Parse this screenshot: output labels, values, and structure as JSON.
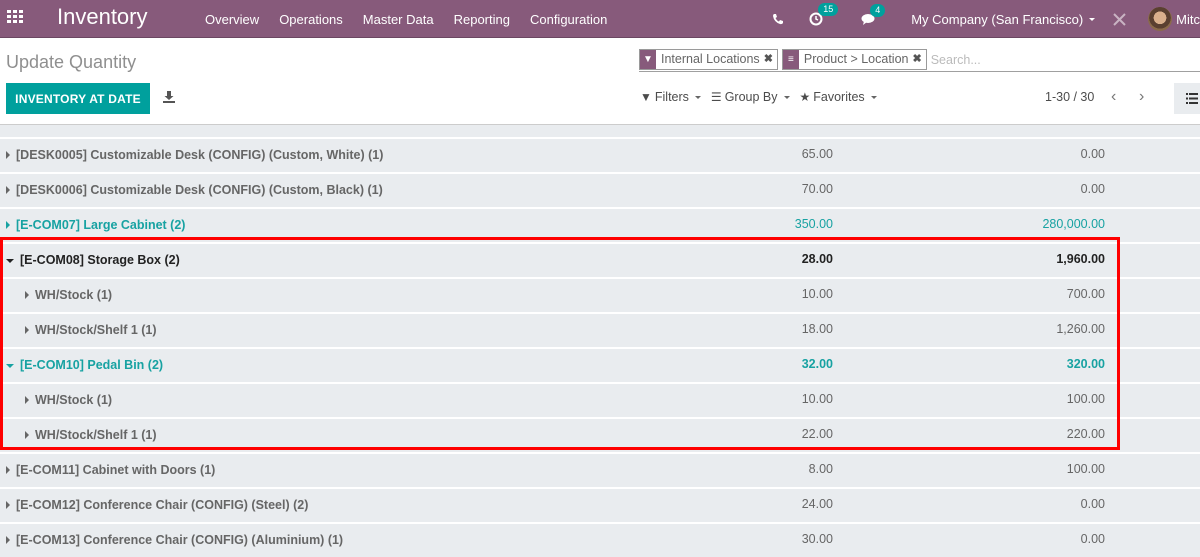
{
  "navbar": {
    "app_title": "Inventory",
    "menu": [
      "Overview",
      "Operations",
      "Master Data",
      "Reporting",
      "Configuration"
    ],
    "activity_count": "15",
    "message_count": "4",
    "company": "My Company (San Francisco)",
    "user_name": "Mitc",
    "colors": {
      "brand": "#875a7b",
      "badge": "#00a09d"
    }
  },
  "control_panel": {
    "breadcrumb": "Update Quantity",
    "primary_button": "INVENTORY AT DATE",
    "search": {
      "facets": [
        {
          "icon": "filter-icon",
          "label": "Internal Locations"
        },
        {
          "icon": "group-by-icon",
          "label": "Product > Location"
        }
      ],
      "placeholder": "Search..."
    },
    "filters_label": "Filters",
    "group_by_label": "Group By",
    "favorites_label": "Favorites",
    "pager": "1-30 / 30"
  },
  "table": {
    "rows": [
      {
        "name": "[DESK0005] Customizable Desk (CONFIG) (Custom, White) (1)",
        "qty": "65.00",
        "value": "0.00"
      },
      {
        "name": "[DESK0006] Customizable Desk (CONFIG) (Custom, Black) (1)",
        "qty": "70.00",
        "value": "0.00"
      },
      {
        "name": "[E-COM07] Large Cabinet (2)",
        "qty": "350.00",
        "value": "280,000.00"
      },
      {
        "name": "[E-COM08] Storage Box (2)",
        "qty": "28.00",
        "value": "1,960.00"
      },
      {
        "name": "WH/Stock (1)",
        "qty": "10.00",
        "value": "700.00"
      },
      {
        "name": "WH/Stock/Shelf 1 (1)",
        "qty": "18.00",
        "value": "1,260.00"
      },
      {
        "name": "[E-COM10] Pedal Bin (2)",
        "qty": "32.00",
        "value": "320.00"
      },
      {
        "name": "WH/Stock (1)",
        "qty": "10.00",
        "value": "100.00"
      },
      {
        "name": "WH/Stock/Shelf 1 (1)",
        "qty": "22.00",
        "value": "220.00"
      },
      {
        "name": "[E-COM11] Cabinet with Doors (1)",
        "qty": "8.00",
        "value": "100.00"
      },
      {
        "name": "[E-COM12] Conference Chair (CONFIG) (Steel) (2)",
        "qty": "24.00",
        "value": "0.00"
      },
      {
        "name": "[E-COM13] Conference Chair (CONFIG) (Aluminium) (1)",
        "qty": "30.00",
        "value": "0.00"
      }
    ],
    "colors": {
      "accent": "#17a2a2",
      "highlight_frame": "#ff0000"
    }
  }
}
